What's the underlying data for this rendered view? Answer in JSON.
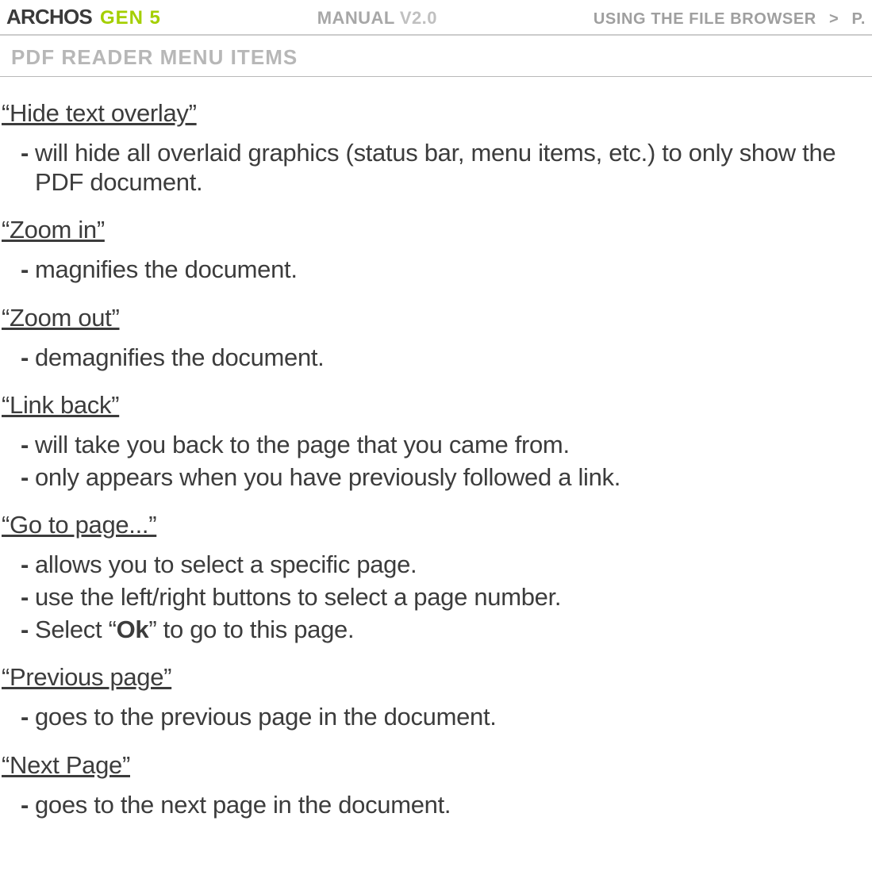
{
  "header": {
    "brand": "ARCHOS",
    "gen": "GEN 5",
    "manual_label": "MANUAL",
    "manual_version": "V2.0",
    "section": "USING THE FILE BROWSER",
    "separator": ">",
    "page_prefix": "P."
  },
  "section_title": "PDF READER MENU ITEMS",
  "items": [
    {
      "title": "“Hide text overlay”",
      "bullets": [
        {
          "text": "will hide all overlaid graphics (status bar, menu items, etc.) to only show the PDF document."
        }
      ]
    },
    {
      "title": "“Zoom in”",
      "bullets": [
        {
          "text": "magnifies the document."
        }
      ]
    },
    {
      "title": "“Zoom out”",
      "bullets": [
        {
          "text": "demagnifies the document."
        }
      ]
    },
    {
      "title": "“Link back”",
      "bullets": [
        {
          "text": "will take you back to the page that you came from."
        },
        {
          "text": "only appears when you have previously followed a link."
        }
      ]
    },
    {
      "title": "“Go to page...”",
      "bullets": [
        {
          "text": "allows you to select a specific page."
        },
        {
          "text": "use the left/right buttons to select a page number."
        },
        {
          "pre": "Select “",
          "bold": "Ok",
          "post": "” to go to this page."
        }
      ]
    },
    {
      "title": "“Previous page”",
      "bullets": [
        {
          "text": "goes to the previous page in the document."
        }
      ]
    },
    {
      "title": "“Next Page”",
      "bullets": [
        {
          "text": "goes to the next page in the document."
        }
      ]
    }
  ]
}
